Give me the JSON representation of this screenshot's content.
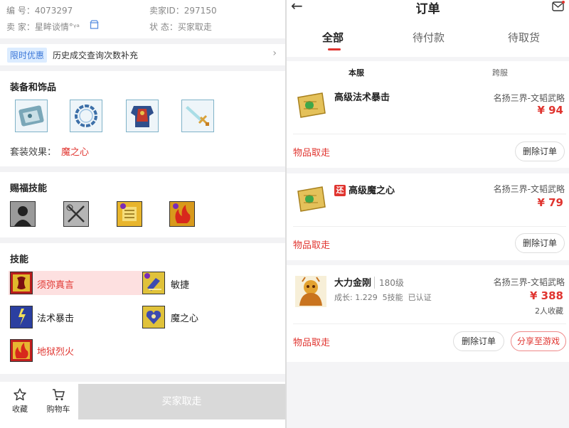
{
  "left": {
    "info": {
      "item_no": "编 号：4073297",
      "seller_id": "卖家ID：297150",
      "seller": "卖 家：星眸谈情°ᵞᵃ",
      "status": "状 态：买家取走"
    },
    "promo": {
      "tag": "限时优惠",
      "text": "历史成交查询次数补充",
      "arrow": "›"
    },
    "equipment": {
      "title": "装备和饰品",
      "items": [
        "map-scroll-icon",
        "ring-icon",
        "armor-icon",
        "sword-icon"
      ],
      "set_label": "套装效果：",
      "set_value": "魔之心"
    },
    "blessing": {
      "title": "赐福技能",
      "icons": [
        "silhouette-skill-icon",
        "crossed-swords-skill-icon",
        "scroll-skill-icon",
        "fire-skill-icon"
      ]
    },
    "skills": {
      "title": "技能",
      "items": [
        {
          "name": "须弥真言",
          "icon": "sumeru-skill-icon",
          "highlight": true
        },
        {
          "name": "敏捷",
          "icon": "agility-skill-icon",
          "highlight": false
        },
        {
          "name": "法术暴击",
          "icon": "spell-crit-skill-icon",
          "highlight": false
        },
        {
          "name": "魔之心",
          "icon": "demon-heart-skill-icon",
          "highlight": false
        },
        {
          "name": "地狱烈火",
          "icon": "hellfire-skill-icon",
          "highlight": true
        }
      ]
    },
    "bottom": {
      "favorite": "收藏",
      "cart": "购物车",
      "buy": "买家取走"
    }
  },
  "right": {
    "title": "订单",
    "back": "←",
    "tabs": [
      "全部",
      "待付款",
      "待取货"
    ],
    "subtabs": [
      "本服",
      "跨服"
    ],
    "orders": [
      {
        "name": "高级法术暴击",
        "server": "名扬三界-文韬武略",
        "price": "¥ 94",
        "status": "物品取走",
        "buttons": [
          "删除订单"
        ]
      },
      {
        "badge": "还",
        "name": "高级魔之心",
        "server": "名扬三界-文韬武略",
        "price": "¥ 79",
        "status": "物品取走",
        "buttons": [
          "删除订单"
        ]
      },
      {
        "name": "大力金刚",
        "level": "180级",
        "detail": "成长: 1.229  5技能  已认证",
        "server": "名扬三界-文韬武略",
        "price": "¥ 388",
        "favorites": "2人收藏",
        "status": "物品取走",
        "buttons": [
          "删除订单",
          "分享至游戏"
        ]
      }
    ]
  },
  "colors": {
    "accent": "#e0342f",
    "promo_bg": "#dcecff",
    "promo_text": "#3d78d8",
    "buy_disabled": "#d9d9d9"
  }
}
